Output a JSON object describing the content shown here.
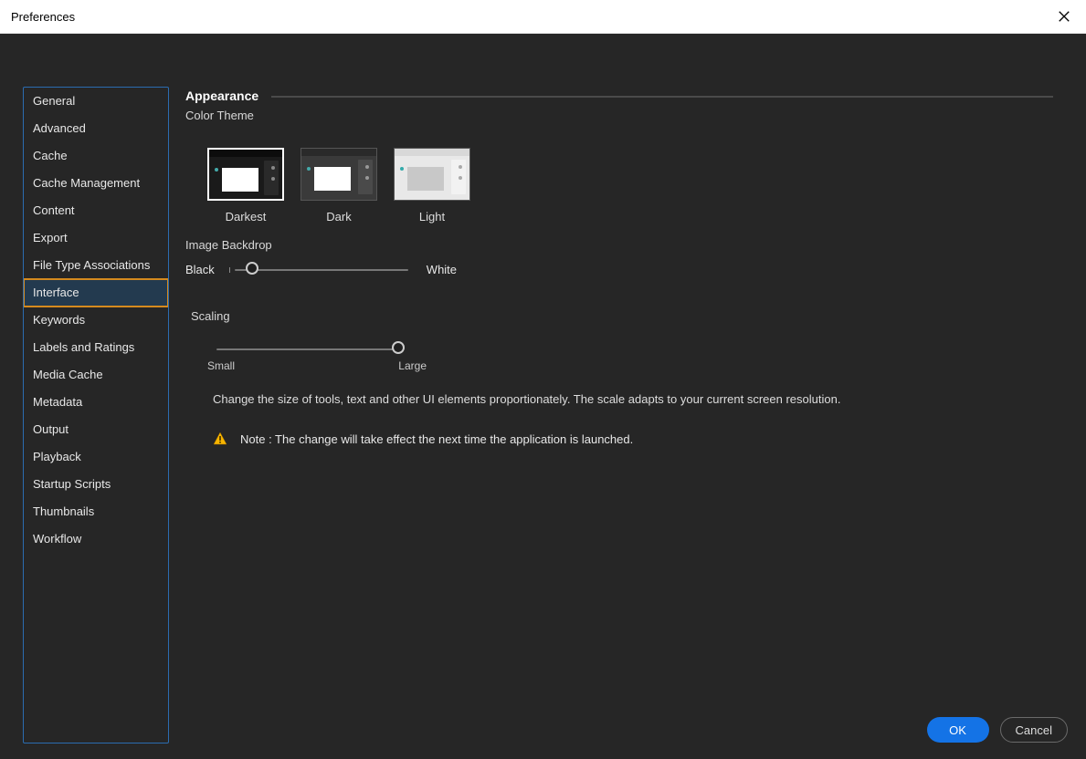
{
  "window": {
    "title": "Preferences"
  },
  "sidebar": {
    "items": [
      {
        "label": "General"
      },
      {
        "label": "Advanced"
      },
      {
        "label": "Cache"
      },
      {
        "label": "Cache Management"
      },
      {
        "label": "Content"
      },
      {
        "label": "Export"
      },
      {
        "label": "File Type Associations"
      },
      {
        "label": "Interface",
        "selected": true
      },
      {
        "label": "Keywords"
      },
      {
        "label": "Labels and Ratings"
      },
      {
        "label": "Media Cache"
      },
      {
        "label": "Metadata"
      },
      {
        "label": "Output"
      },
      {
        "label": "Playback"
      },
      {
        "label": "Startup Scripts"
      },
      {
        "label": "Thumbnails"
      },
      {
        "label": "Workflow"
      }
    ]
  },
  "appearance": {
    "section_title": "Appearance",
    "color_theme_label": "Color Theme",
    "themes": [
      {
        "label": "Darkest",
        "selected": true
      },
      {
        "label": "Dark"
      },
      {
        "label": "Light"
      }
    ],
    "backdrop_label": "Image Backdrop",
    "backdrop_min": "Black",
    "backdrop_max": "White",
    "backdrop_value_percent": 10
  },
  "scaling": {
    "label": "Scaling",
    "min_label": "Small",
    "max_label": "Large",
    "value_percent": 100,
    "description": "Change the size of tools, text and other UI elements proportionately. The scale adapts to your current screen resolution.",
    "note": "Note : The change will take effect the next time the application is launched."
  },
  "footer": {
    "ok": "OK",
    "cancel": "Cancel"
  }
}
